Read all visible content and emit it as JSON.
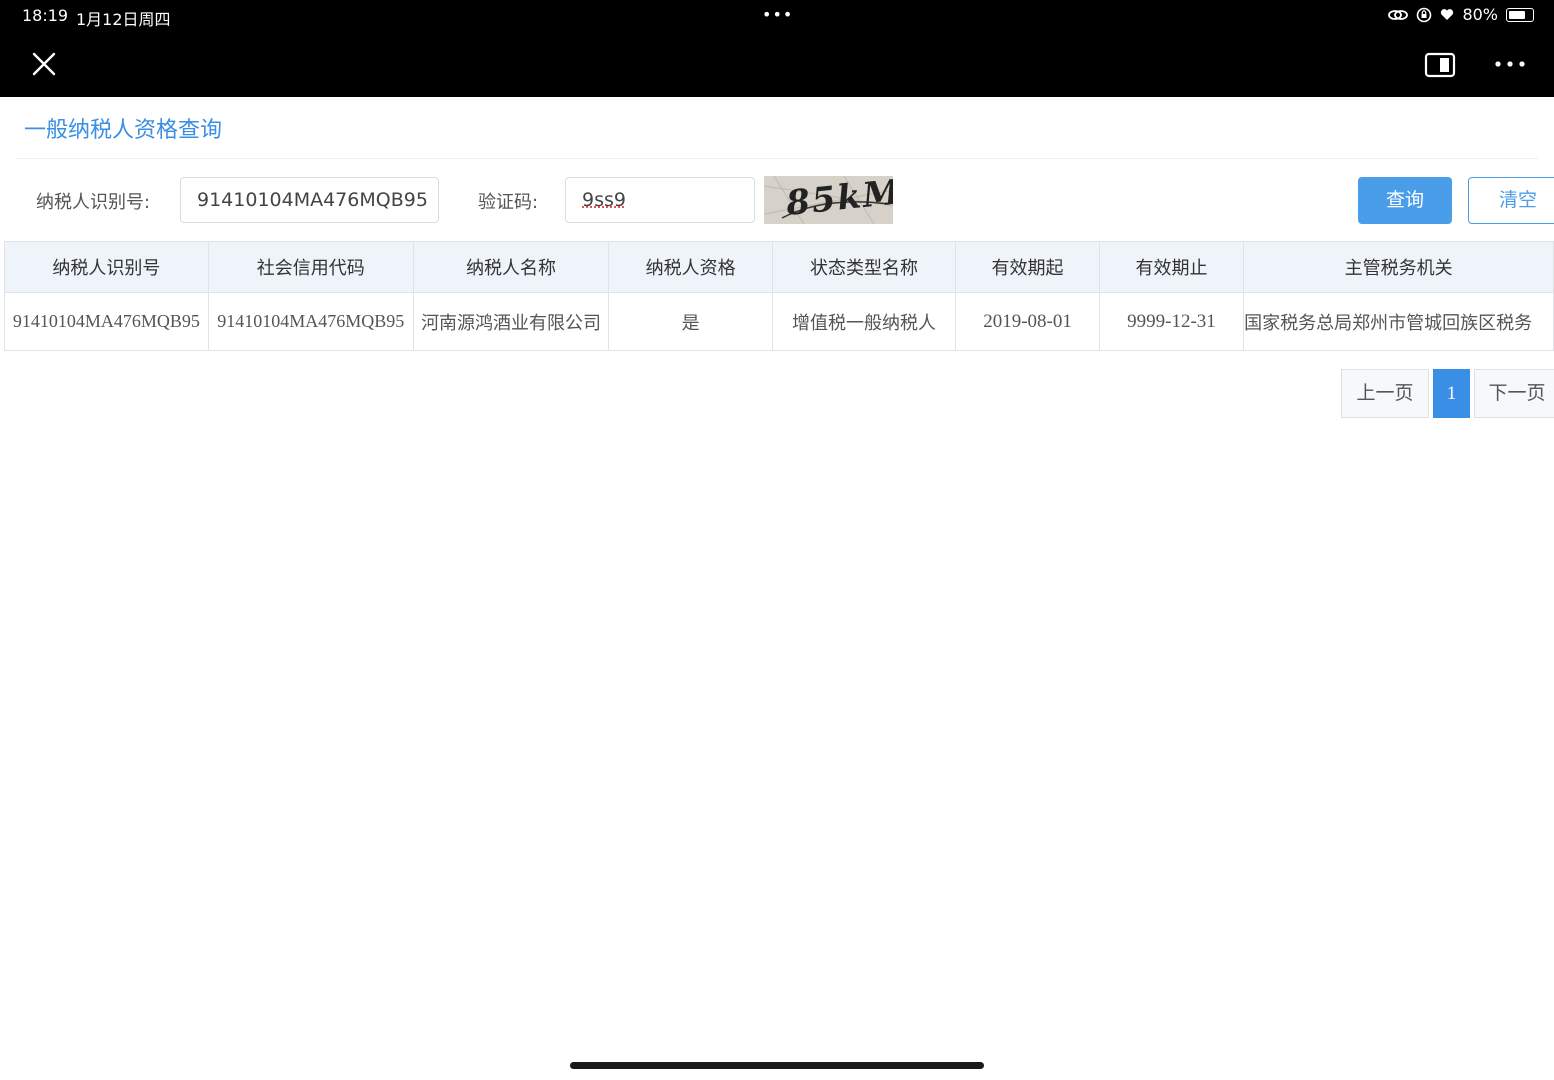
{
  "status_bar": {
    "time": "18:19",
    "date": "1月12日周四",
    "center_dots": "•••",
    "battery_percent": "80%",
    "battery_level": 0.8
  },
  "page": {
    "title": "一般纳税人资格查询"
  },
  "search": {
    "taxpayer_id_label": "纳税人识别号:",
    "taxpayer_id_value": "91410104MA476MQB95",
    "captcha_label": "验证码:",
    "captcha_value": "9ss9",
    "captcha_image_text": "85kM",
    "query_label": "查询",
    "clear_label": "清空"
  },
  "table": {
    "columns": [
      "纳税人识别号",
      "社会信用代码",
      "纳税人名称",
      "纳税人资格",
      "状态类型名称",
      "有效期起",
      "有效期止",
      "主管税务机关"
    ],
    "rows": [
      [
        "91410104MA476MQB95",
        "91410104MA476MQB95",
        "河南源鸿酒业有限公司",
        "是",
        "增值税一般纳税人",
        "2019-08-01",
        "9999-12-31",
        "国家税务总局郑州市管城回族区税务"
      ]
    ]
  },
  "pagination": {
    "prev_label": "上一页",
    "current_page": "1",
    "next_label": "下一页"
  },
  "colors": {
    "accent": "#3a8ee6",
    "button": "#4a9de8",
    "header_bg": "#eef4fa"
  }
}
